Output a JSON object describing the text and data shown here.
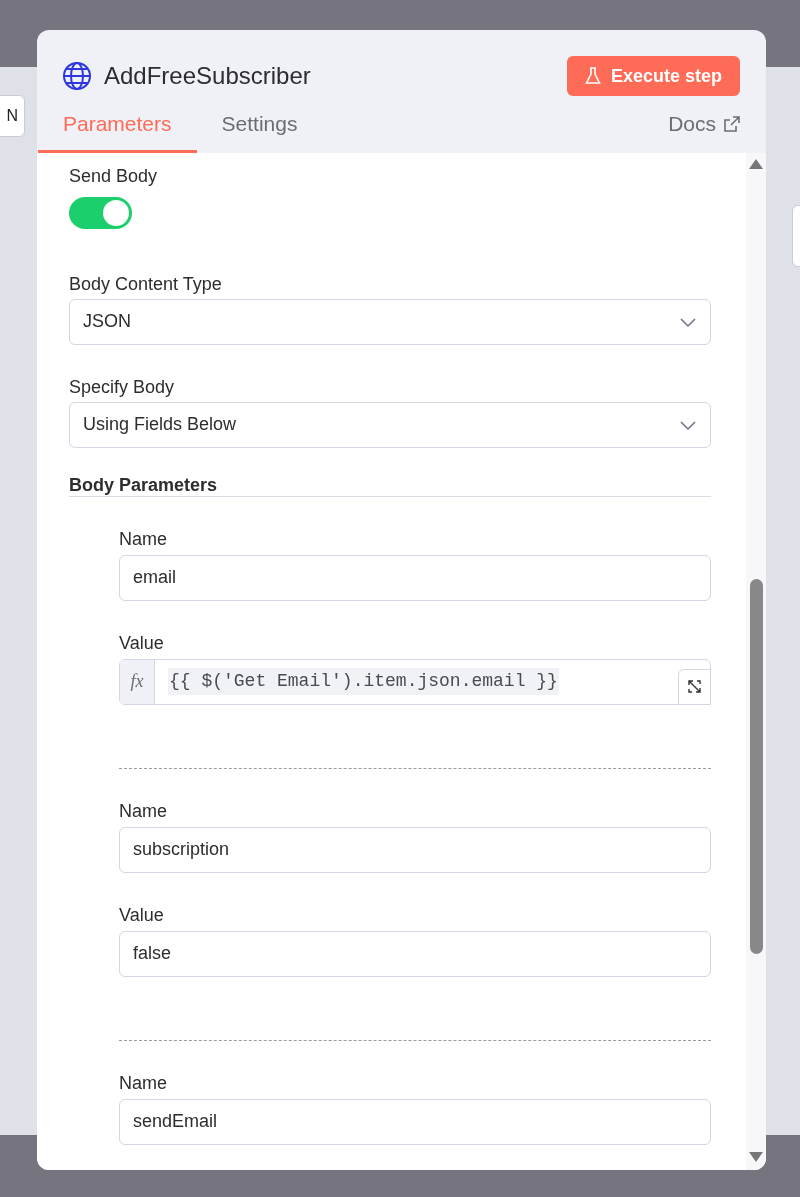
{
  "background": {
    "left_button": "N"
  },
  "node": {
    "title": "AddFreeSubscriber",
    "execute_button": "Execute step"
  },
  "tabs": [
    {
      "label": "Parameters",
      "selected": true
    },
    {
      "label": "Settings",
      "selected": false
    }
  ],
  "docs_link": "Docs",
  "send_body": {
    "label": "Send Body",
    "on": true
  },
  "selects": [
    {
      "label": "Body Content Type",
      "value": "JSON"
    },
    {
      "label": "Specify Body",
      "value": "Using Fields Below"
    }
  ],
  "body_parameters": {
    "title": "Body Parameters",
    "items": [
      {
        "name_label": "Name",
        "name": "email",
        "value_label": "Value",
        "value": "{{ $('Get Email').item.json.email }}",
        "kind": "expression",
        "fx": "fx"
      },
      {
        "name_label": "Name",
        "name": "subscription",
        "value_label": "Value",
        "value": "false",
        "kind": "fixed"
      },
      {
        "name_label": "Name",
        "name": "sendEmail"
      }
    ]
  }
}
